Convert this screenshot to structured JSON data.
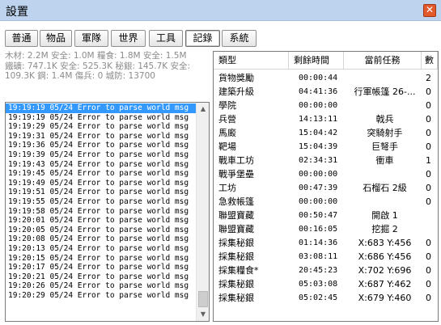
{
  "window": {
    "title": "設置",
    "close_label": "✕"
  },
  "tabs": [
    {
      "label": "普通",
      "active": false
    },
    {
      "label": "物品",
      "active": false
    },
    {
      "label": "軍隊",
      "active": false
    },
    {
      "label": "世界",
      "active": false
    },
    {
      "label": "工具",
      "active": false
    },
    {
      "label": "記錄",
      "active": true
    },
    {
      "label": "系統",
      "active": false
    }
  ],
  "resources": {
    "line1": "木材: 2.2M 安全: 1.0M  糧食: 1.8M 安全: 1.5M",
    "line2": "鐵礦: 747.1K 安全: 525.3K  秘銀: 145.7K 安全:",
    "line3": "109.3K  鋼: 1.4M  傷兵: 0  城防: 13700"
  },
  "log": {
    "entries": [
      "19:19:19 05/24 Error to parse world msg",
      "19:19:19 05/24 Error to parse world msg",
      "19:19:29 05/24 Error to parse world msg",
      "19:19:31 05/24 Error to parse world msg",
      "19:19:36 05/24 Error to parse world msg",
      "19:19:39 05/24 Error to parse world msg",
      "19:19:43 05/24 Error to parse world msg",
      "19:19:45 05/24 Error to parse world msg",
      "19:19:49 05/24 Error to parse world msg",
      "19:19:51 05/24 Error to parse world msg",
      "19:19:55 05/24 Error to parse world msg",
      "19:19:58 05/24 Error to parse world msg",
      "19:20:01 05/24 Error to parse world msg",
      "19:20:05 05/24 Error to parse world msg",
      "19:20:08 05/24 Error to parse world msg",
      "19:20:13 05/24 Error to parse world msg",
      "19:20:15 05/24 Error to parse world msg",
      "19:20:17 05/24 Error to parse world msg",
      "19:20:21 05/24 Error to parse world msg",
      "19:20:26 05/24 Error to parse world msg",
      "19:20:29 05/24 Error to parse world msg"
    ],
    "selected_index": 0
  },
  "tasks": {
    "headers": [
      "類型",
      "剩餘時間",
      "當前任務",
      "數"
    ],
    "rows": [
      {
        "type": "貨物獎勵",
        "time": "00:00:44",
        "task": "",
        "num": "2"
      },
      {
        "type": "建築升級",
        "time": "04:41:36",
        "task": "行軍帳篷 26-...",
        "num": "0"
      },
      {
        "type": "學院",
        "time": "00:00:00",
        "task": "",
        "num": "0"
      },
      {
        "type": "兵營",
        "time": "14:13:11",
        "task": "戟兵",
        "num": "0"
      },
      {
        "type": "馬廄",
        "time": "15:04:42",
        "task": "突騎射手",
        "num": "0"
      },
      {
        "type": "靶場",
        "time": "15:04:39",
        "task": "巨弩手",
        "num": "0"
      },
      {
        "type": "戰車工坊",
        "time": "02:34:31",
        "task": "衝車",
        "num": "1"
      },
      {
        "type": "戰爭堡壘",
        "time": "00:00:00",
        "task": "",
        "num": "0"
      },
      {
        "type": "工坊",
        "time": "00:47:39",
        "task": "石榴石 2級",
        "num": "0"
      },
      {
        "type": "急救帳篷",
        "time": "00:00:00",
        "task": "",
        "num": "0"
      },
      {
        "type": "聯盟寶藏",
        "time": "00:50:47",
        "task": "開啟 1",
        "num": ""
      },
      {
        "type": "聯盟寶藏",
        "time": "00:16:05",
        "task": "挖掘 2",
        "num": ""
      },
      {
        "type": "採集秘銀",
        "time": "01:14:36",
        "task": "X:683 Y:456",
        "num": "0"
      },
      {
        "type": "採集秘銀",
        "time": "03:08:11",
        "task": "X:686 Y:456",
        "num": "0"
      },
      {
        "type": "採集糧食*",
        "time": "20:45:23",
        "task": "X:702 Y:696",
        "num": "0"
      },
      {
        "type": "採集秘銀",
        "time": "05:03:08",
        "task": "X:687 Y:462",
        "num": "0"
      },
      {
        "type": "採集秘銀",
        "time": "05:02:45",
        "task": "X:679 Y:460",
        "num": "0"
      }
    ]
  },
  "icons": {
    "scroll_up": "▲",
    "scroll_down": "▼"
  }
}
